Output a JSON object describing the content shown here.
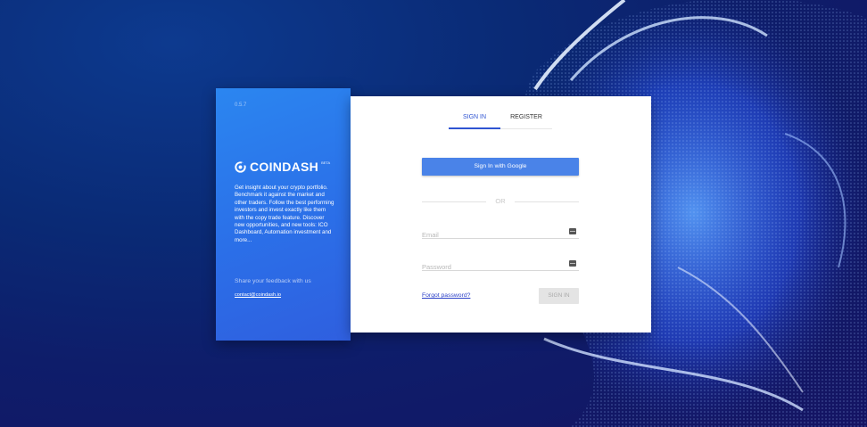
{
  "brand_panel": {
    "version": "0.5.7",
    "logo_name": "COINDASH",
    "beta_badge": "BETA",
    "description": "Get insight about your crypto portfolio. Benchmark it against the market and other traders. Follow the best performing investors and invest exactly like them with the copy trade feature. Discover new opportunities, and new tools: ICO Dashboard, Automation investment and more...",
    "feedback_label": "Share your feedback with us",
    "contact_email": "contact@coindash.io"
  },
  "auth": {
    "tabs": [
      {
        "label": "SIGN IN",
        "active": true
      },
      {
        "label": "REGISTER",
        "active": false
      }
    ],
    "google_button": "Sign In with Google",
    "divider_text": "OR",
    "email": {
      "value": "",
      "placeholder": "Email",
      "icon": "keyboard-icon"
    },
    "password": {
      "value": "",
      "placeholder": "Password",
      "icon": "keyboard-icon"
    },
    "forgot_link": "Forgot password?",
    "submit_button": "SIGN IN"
  },
  "colors": {
    "accent": "#2f54d2",
    "google_button": "#4a83e8",
    "brand_panel": "#2b7aee",
    "background": "#0a2a75"
  }
}
